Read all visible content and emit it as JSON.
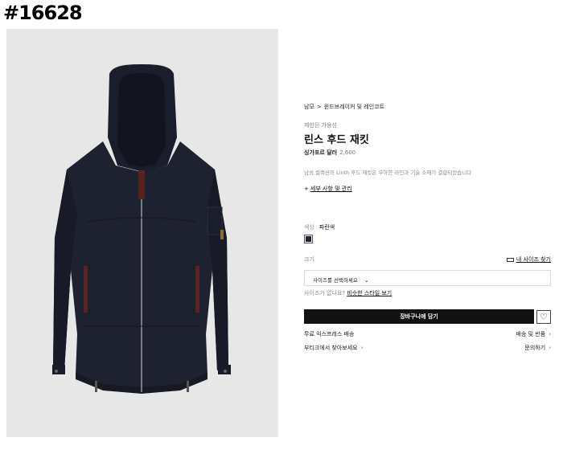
{
  "page_id": "#16628",
  "breadcrumb": {
    "home": "남모",
    "sep": ">",
    "category": "윈드브레이커 및 레인코트"
  },
  "availability": "제한된 가용성",
  "product": {
    "title": "린스 후드 재킷",
    "price_label": "싱가포르 달러",
    "price_value": "2,600",
    "description": "남성 컬렉션의 Linth 후드 재킷은 우아한 라인과 기술 소재가 결합되었습니다",
    "details_link": "세부 사항 및 관리",
    "details_icon": "+"
  },
  "color": {
    "label": "색상",
    "value": "파란색",
    "swatch_hex": "#1c2233"
  },
  "size": {
    "label": "크기",
    "guide_link": "내 사이즈 찾기",
    "select_placeholder": "사이즈를 선택하세요",
    "select_chevron": "⌄",
    "help_text": "사이즈가 없나요?",
    "help_link": "비슷한 스타일 보기"
  },
  "actions": {
    "add_to_cart": "장바구니에 담기",
    "wishlist_icon": "♡"
  },
  "services": [
    {
      "left": "무료 익스프레스 배송",
      "right": "배송 및 반품",
      "arrow": "›"
    },
    {
      "left": "부티크에서 찾아보세요",
      "left_arrow": "›",
      "right": "문의하기",
      "arrow": "›"
    }
  ],
  "colors": {
    "jacket": "#1e2130",
    "trim": "#5a2320",
    "background": "#e7e7e7",
    "button": "#111111"
  }
}
